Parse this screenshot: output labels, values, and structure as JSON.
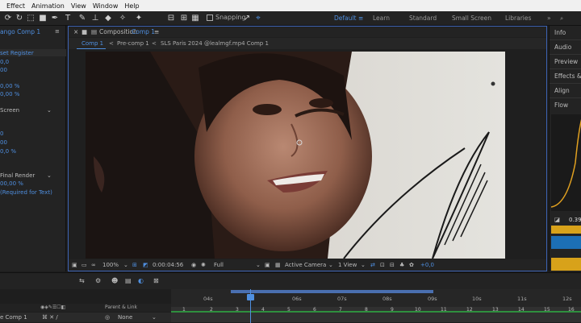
{
  "menubar": {
    "items": [
      "Effect",
      "Animation",
      "View",
      "Window",
      "Help"
    ]
  },
  "toolbar": {
    "snapping_label": "Snapping",
    "workspaces": [
      "Default",
      "Learn",
      "Standard",
      "Small Screen",
      "Libraries"
    ]
  },
  "left_panel": {
    "tab": "ango Comp 1",
    "rows": [
      "set   Register",
      "0,0",
      "00",
      "0,00 %",
      "0,00 %",
      "Screen",
      "0",
      "00",
      "0,0 %",
      "Final Render",
      "00,00 %",
      "(Required for Text)"
    ]
  },
  "composition": {
    "title_prefix": "Composition",
    "title_name": "Comp 1",
    "tabs": [
      "Comp 1",
      "Pre-comp 1",
      "SLS Paris 2024 @lealmgf.mp4 Comp 1"
    ],
    "footer": {
      "zoom": "100%",
      "timecode": "0:00:04:56",
      "resolution": "Full",
      "camera": "Active Camera",
      "views": "1 View",
      "exposure": "+0,0"
    }
  },
  "right_panel": {
    "items": [
      "Info",
      "Audio",
      "Preview",
      "Effects & P",
      "Align",
      "Flow"
    ],
    "value": "0.39"
  },
  "timeline": {
    "ruler_labels": [
      "04s",
      "06s",
      "07s",
      "08s",
      "09s",
      "10s",
      "11s",
      "12s"
    ],
    "marker_labels": [
      "1",
      "2",
      "3",
      "4",
      "5",
      "6",
      "7",
      "8",
      "9",
      "10",
      "11",
      "12",
      "13",
      "14",
      "15",
      "16"
    ],
    "headers": {
      "parent_link": "Parent & Link"
    },
    "layer": {
      "name": "e Comp 1",
      "parent": "None"
    }
  }
}
